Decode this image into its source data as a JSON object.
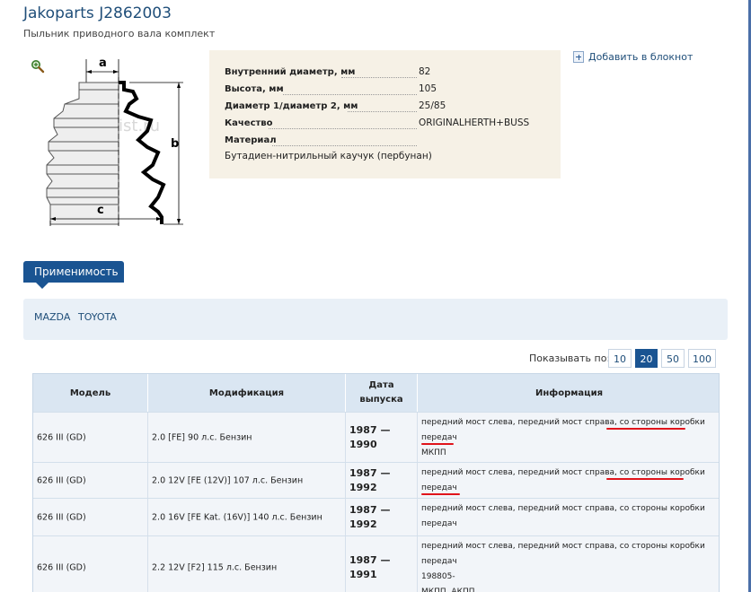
{
  "product": {
    "title": "Jakoparts  J2862003",
    "subtitle": "Пыльник приводного вала комплект"
  },
  "image": {
    "watermark": "Exist.ru",
    "dim_a": "a",
    "dim_b": "b",
    "dim_c": "c",
    "zoom_icon": "magnifier-icon"
  },
  "properties": [
    {
      "label": "Внутренний диаметр, мм",
      "value": "82"
    },
    {
      "label": "Высота, мм",
      "value": "105"
    },
    {
      "label": "Диаметр 1/диаметр 2, мм",
      "value": "25/85"
    },
    {
      "label": "Качество",
      "value": "ORIGINALHERTH+BUSS"
    },
    {
      "label": "Материал",
      "value": "Бутадиен-нитрильный каучук (пербунан)"
    }
  ],
  "notebook": {
    "label": "Добавить в блокнот",
    "icon": "notebook-add-icon"
  },
  "applicability": {
    "tab_label": "Применимость",
    "brands": [
      "MAZDA",
      "TOYOTA"
    ]
  },
  "pagination": {
    "label": "Показывать по:",
    "options": [
      "10",
      "20",
      "50",
      "100"
    ],
    "selected": "20"
  },
  "table": {
    "headers": {
      "model": "Модель",
      "modification": "Модификация",
      "date_line1": "Дата",
      "date_line2": "выпуска",
      "info": "Информация"
    },
    "rows": [
      {
        "model": "626 III (GD)",
        "modification": "2.0 [FE] 90 л.с. Бензин",
        "date_from": "1987 —",
        "date_to": "1990",
        "info_lines": [
          "передний мост слева, передний мост справа, со стороны коробки",
          "передач",
          "МКПП"
        ]
      },
      {
        "model": "626 III (GD)",
        "modification": "2.0 12V [FE (12V)] 107 л.с. Бензин",
        "date_from": "1987 —",
        "date_to": "1992",
        "info_lines": [
          "передний мост слева, передний мост справа, со стороны коробки",
          "передач"
        ]
      },
      {
        "model": "626 III (GD)",
        "modification": "2.0 16V [FE Kat. (16V)] 140 л.с. Бензин",
        "date_from": "1987 —",
        "date_to": "1992",
        "info_lines": [
          "передний мост слева, передний мост справа, со стороны коробки",
          "передач"
        ]
      },
      {
        "model": "626 III (GD)",
        "modification": "2.2 12V [F2] 115 л.с. Бензин",
        "date_from": "1987 —",
        "date_to": "1991",
        "info_lines": [
          "передний мост слева, передний мост справа, со стороны коробки",
          "передач",
          "198805-",
          "МКПП, АКПП"
        ]
      }
    ]
  },
  "colors": {
    "accent": "#1a5492",
    "title": "#1f4e79",
    "annotation": "#e0141b"
  }
}
